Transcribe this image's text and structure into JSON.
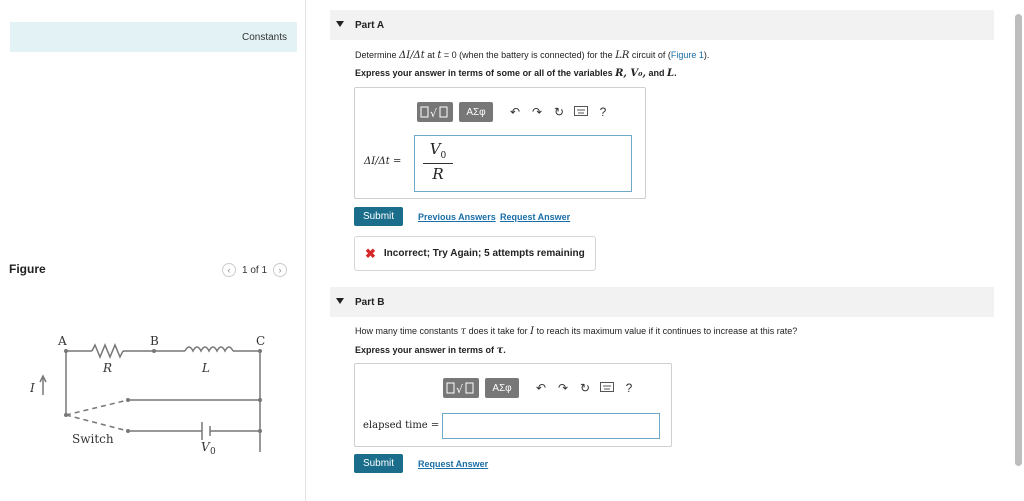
{
  "left_panel": {
    "constants_label": "Constants",
    "figure_label": "Figure",
    "pager_text": "1 of 1",
    "circuit": {
      "node_a": "A",
      "node_b": "B",
      "node_c": "C",
      "resistor": "R",
      "inductor": "L",
      "current": "I",
      "switch": "Switch",
      "battery_v": "V",
      "battery_sub": "0"
    }
  },
  "part_a": {
    "title": "Part A",
    "q_pre": "Determine ",
    "q_expr": "ΔI/Δt",
    "q_mid1": " at ",
    "q_t": "t",
    "q_mid2": " = 0 (when the battery is connected) for the ",
    "q_lr": "LR",
    "q_mid3": " circuit of (",
    "q_link": "Figure 1",
    "q_end": ").",
    "instr_pre": "Express your answer in terms of some or all of the variables ",
    "instr_vars": "R, V₀,",
    "instr_and": " and ",
    "instr_l": "L",
    "instr_end": ".",
    "answer_label": "ΔI/Δt =",
    "numerator_v": "V",
    "numerator_sub": "0",
    "denominator": "R",
    "submit_label": "Submit",
    "prev_answers": "Previous Answers",
    "request_answer": "Request Answer",
    "feedback": "Incorrect; Try Again; 5 attempts remaining"
  },
  "part_b": {
    "title": "Part B",
    "q_pre": "How many time constants ",
    "q_tau": "τ",
    "q_mid": " does it take for ",
    "q_i": "I",
    "q_end": " to reach its maximum value if it continues to increase at this rate?",
    "instr_pre": "Express your answer in terms of ",
    "instr_tau": "τ",
    "instr_end": ".",
    "answer_label": "elapsed time =",
    "submit_label": "Submit",
    "request_answer": "Request Answer"
  },
  "toolbar": {
    "template_icon": "template-icon",
    "greek_label": "ΑΣφ",
    "undo_icon": "undo-icon",
    "redo_icon": "redo-icon",
    "reset_icon": "reset-icon",
    "keyboard_icon": "keyboard-icon",
    "help_label": "?"
  },
  "colors": {
    "accent": "#1a6e8c",
    "link": "#1a6ea8",
    "error": "#d62828",
    "constants_bg": "#e3f3f5"
  }
}
